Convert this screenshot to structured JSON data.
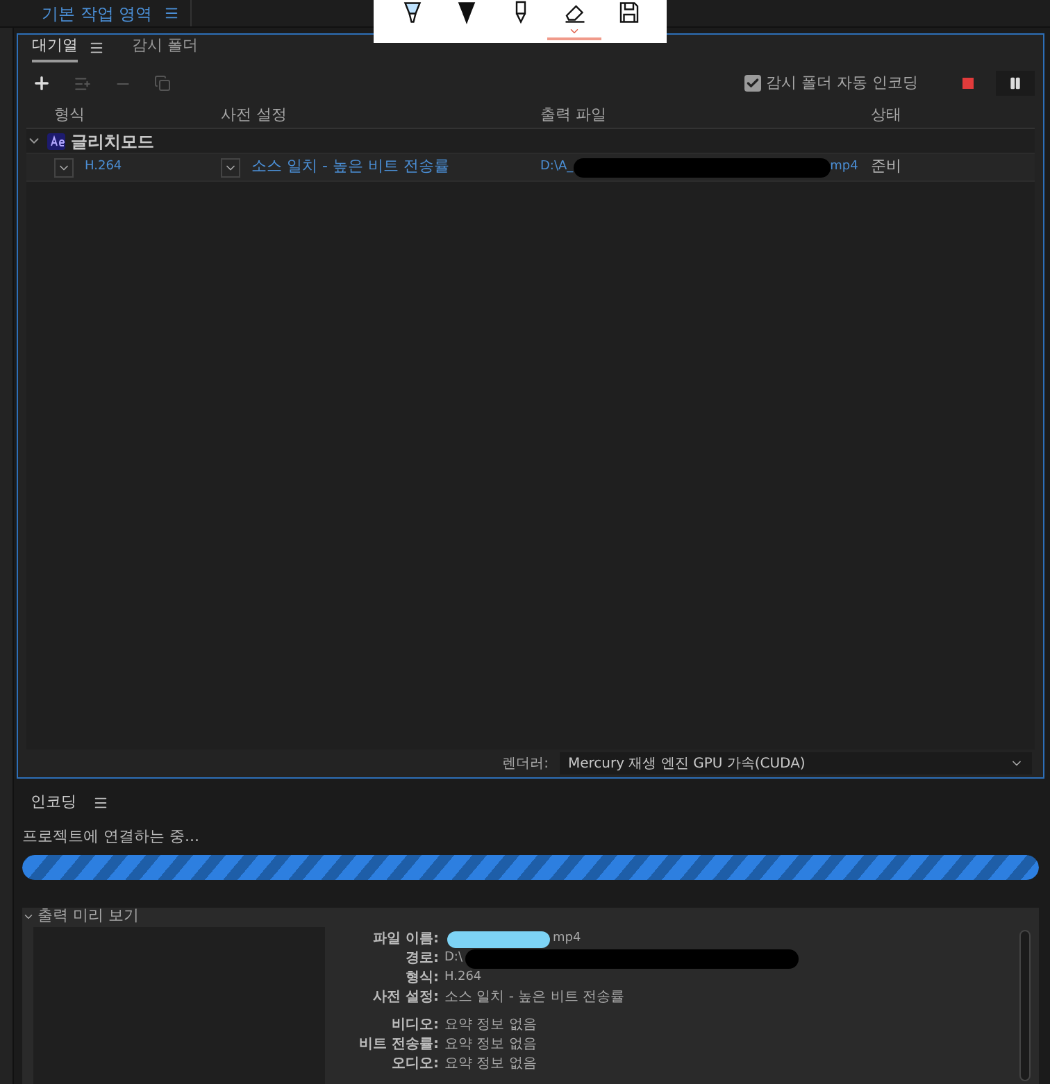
{
  "workspace": {
    "label": "기본 작업 영역"
  },
  "pen_toolbar": {
    "tools": [
      {
        "kind": "highlighter",
        "selected": false
      },
      {
        "kind": "pen",
        "selected": false
      },
      {
        "kind": "pencil",
        "selected": false
      },
      {
        "kind": "eraser",
        "selected": true
      },
      {
        "kind": "save",
        "selected": false
      }
    ]
  },
  "queue_panel": {
    "tabs": [
      {
        "label": "대기열",
        "selected": true
      },
      {
        "label": "감시 폴더",
        "selected": false
      }
    ],
    "auto_encode": {
      "label": "감시 폴더 자동 인코딩",
      "checked": true
    },
    "columns": [
      "형식",
      "사전 설정",
      "출력 파일",
      "상태"
    ],
    "groups": [
      {
        "name": "글리치모드",
        "expanded": true,
        "items": [
          {
            "format": "H.264",
            "preset": "소스 일치 - 높은 비트 전송률",
            "output_start": "D:\\A_",
            "output_end": "mp4",
            "status": "준비"
          }
        ]
      }
    ],
    "renderer": {
      "label": "렌더러:",
      "value": "Mercury 재생 엔진 GPU 가속(CUDA)"
    }
  },
  "encoding_panel": {
    "title": "인코딩",
    "status": "프로젝트에 연결하는 중...",
    "level": 1,
    "preview": {
      "title": "출력 미리 보기",
      "expanded": true,
      "file_fields": [
        {
          "label": "파일 이름:",
          "value": "mp4",
          "kind": "masked_before"
        },
        {
          "label": "경로:",
          "value": "D:\\",
          "kind": "masked_after"
        },
        {
          "label": "형식:",
          "value": "H.264",
          "kind": "plain"
        },
        {
          "label": "사전 설정:",
          "value": "소스 일치 - 높은 비트 전송률",
          "kind": "plain"
        }
      ],
      "summary_fields": [
        {
          "label": "비디오:",
          "value": "요약 정보 없음"
        },
        {
          "label": "비트 전송률:",
          "value": "요약 정보 없음"
        },
        {
          "label": "오디오:",
          "value": "요약 정보 없음"
        }
      ]
    }
  }
}
